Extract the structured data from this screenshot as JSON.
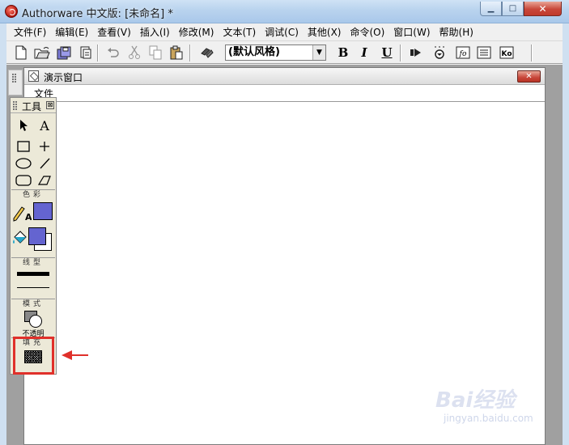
{
  "window": {
    "title": "Authorware 中文版: [未命名] *",
    "min_symbol": "▁",
    "max_symbol": "□",
    "close_symbol": "✕"
  },
  "menubar": {
    "items": [
      {
        "label": "文件(F)"
      },
      {
        "label": "编辑(E)"
      },
      {
        "label": "查看(V)"
      },
      {
        "label": "插入(I)"
      },
      {
        "label": "修改(M)"
      },
      {
        "label": "文本(T)"
      },
      {
        "label": "调试(C)"
      },
      {
        "label": "其他(X)"
      },
      {
        "label": "命令(O)"
      },
      {
        "label": "窗口(W)"
      },
      {
        "label": "帮助(H)"
      }
    ]
  },
  "toolbar": {
    "style_value": "(默认风格)",
    "bold_label": "B",
    "italic_label": "I",
    "underline_label": "U",
    "fo_label": "fo",
    "ko_label": "Ko",
    "icons": [
      "new-icon",
      "open-icon",
      "save-all-icon",
      "import-icon",
      "undo-icon",
      "cut-icon",
      "copy-icon",
      "paste-icon",
      "find-icon",
      "run-icon",
      "control-panel-icon",
      "functions-icon",
      "variables-icon",
      "knowledge-objects-icon"
    ]
  },
  "presentation": {
    "title": "演示窗口",
    "menu_file": "文件",
    "close_symbol": "✕"
  },
  "tools_palette": {
    "title": "工具",
    "close_symbol": "⊠",
    "text_tool_label": "A",
    "color_label": "色彩",
    "line_label": "线型",
    "mode_label": "模式",
    "mode_value": "不透明",
    "fill_label": "填充",
    "fill_color": "#6464d0"
  },
  "watermark": {
    "text": "Bai经验",
    "sub": "jingyan.baidu.com"
  }
}
